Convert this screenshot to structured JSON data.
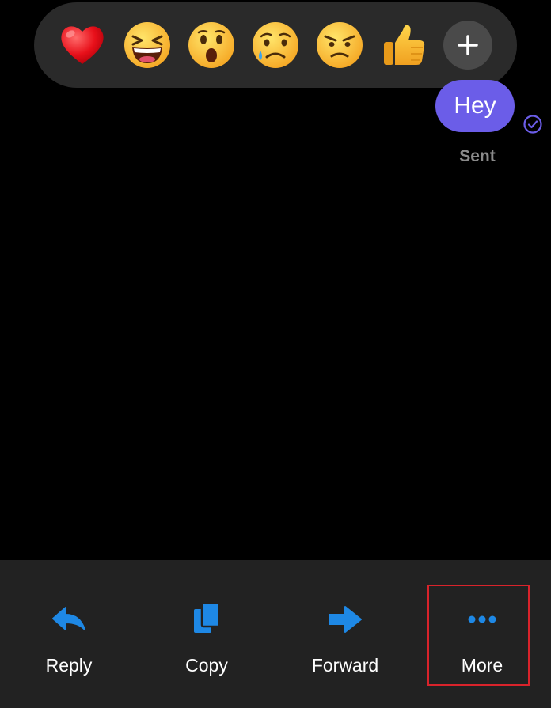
{
  "reactions": {
    "items": [
      {
        "name": "heart",
        "label": "Love"
      },
      {
        "name": "laughing",
        "label": "Haha"
      },
      {
        "name": "surprised",
        "label": "Wow"
      },
      {
        "name": "sad",
        "label": "Sad"
      },
      {
        "name": "angry",
        "label": "Angry"
      },
      {
        "name": "thumbs-up",
        "label": "Like"
      }
    ],
    "more_icon": "plus-icon"
  },
  "message": {
    "text": "Hey",
    "status": "Sent",
    "bubble_color": "#6b5de8"
  },
  "actions": {
    "reply_label": "Reply",
    "copy_label": "Copy",
    "forward_label": "Forward",
    "more_label": "More",
    "icon_color": "#1e88e5"
  },
  "highlight_color": "#d9232b"
}
